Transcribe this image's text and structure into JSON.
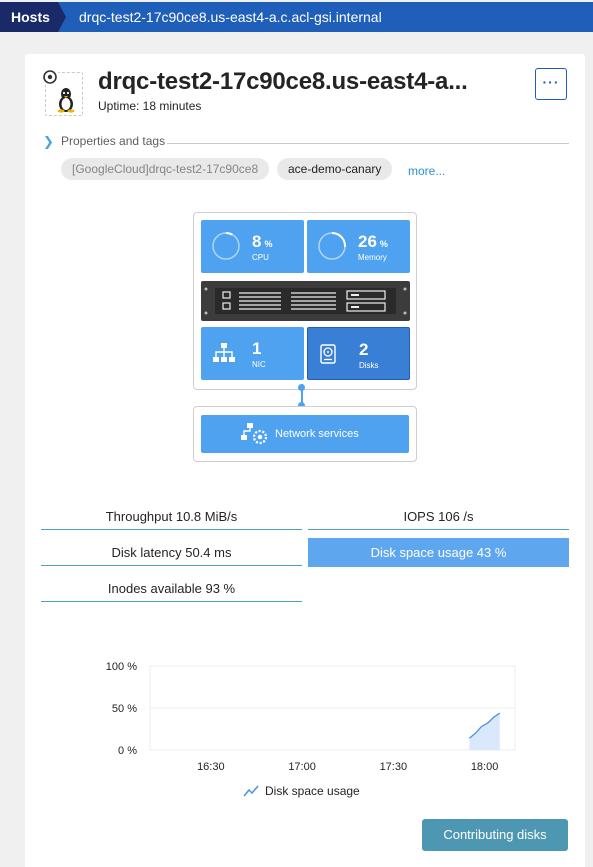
{
  "breadcrumb": {
    "hosts_label": "Hosts",
    "host_label": "drqc-test2-17c90ce8.us-east4-a.c.acl-gsi.internal"
  },
  "header": {
    "title": "drqc-test2-17c90ce8.us-east4-a...",
    "uptime": "Uptime: 18 minutes",
    "menu_label": "···",
    "os_icon": "linux-tux-icon"
  },
  "properties": {
    "label": "Properties and tags",
    "tags": [
      "[GoogleCloud]drqc-test2-17c90ce8",
      "ace-demo-canary"
    ],
    "more_label": "more..."
  },
  "infographic": {
    "cpu": {
      "value": "8",
      "unit": "%",
      "label": "CPU",
      "fraction": 0.08
    },
    "memory": {
      "value": "26",
      "unit": "%",
      "label": "Memory",
      "fraction": 0.26
    },
    "nic": {
      "value": "1",
      "label": "NIC"
    },
    "disks": {
      "value": "2",
      "label": "Disks"
    },
    "network_services_label": "Network services",
    "colors": {
      "tile": "#4fa2ef",
      "tile_selected": "#3a7fd6"
    }
  },
  "metrics": {
    "throughput": "Throughput 10.8 MiB/s",
    "iops": "IOPS 106 /s",
    "disk_latency": "Disk latency 50.4 ms",
    "disk_space": "Disk space usage 43 %",
    "inodes": "Inodes available 93 %"
  },
  "chart_data": {
    "type": "area",
    "y_ticks": [
      "100 %",
      "50 %",
      "0 %"
    ],
    "x_ticks": [
      "16:30",
      "17:00",
      "17:30",
      "18:00"
    ],
    "ylim": [
      0,
      100
    ],
    "series": [
      {
        "name": "Disk space usage",
        "x": [
          "17:55",
          "17:57",
          "17:59",
          "18:01",
          "18:03",
          "18:05"
        ],
        "values": [
          14,
          20,
          28,
          32,
          39,
          44
        ]
      }
    ],
    "legend": "bottom",
    "color": "#4a90e2"
  },
  "actions": {
    "contributing_disks_label": "Contributing disks"
  }
}
